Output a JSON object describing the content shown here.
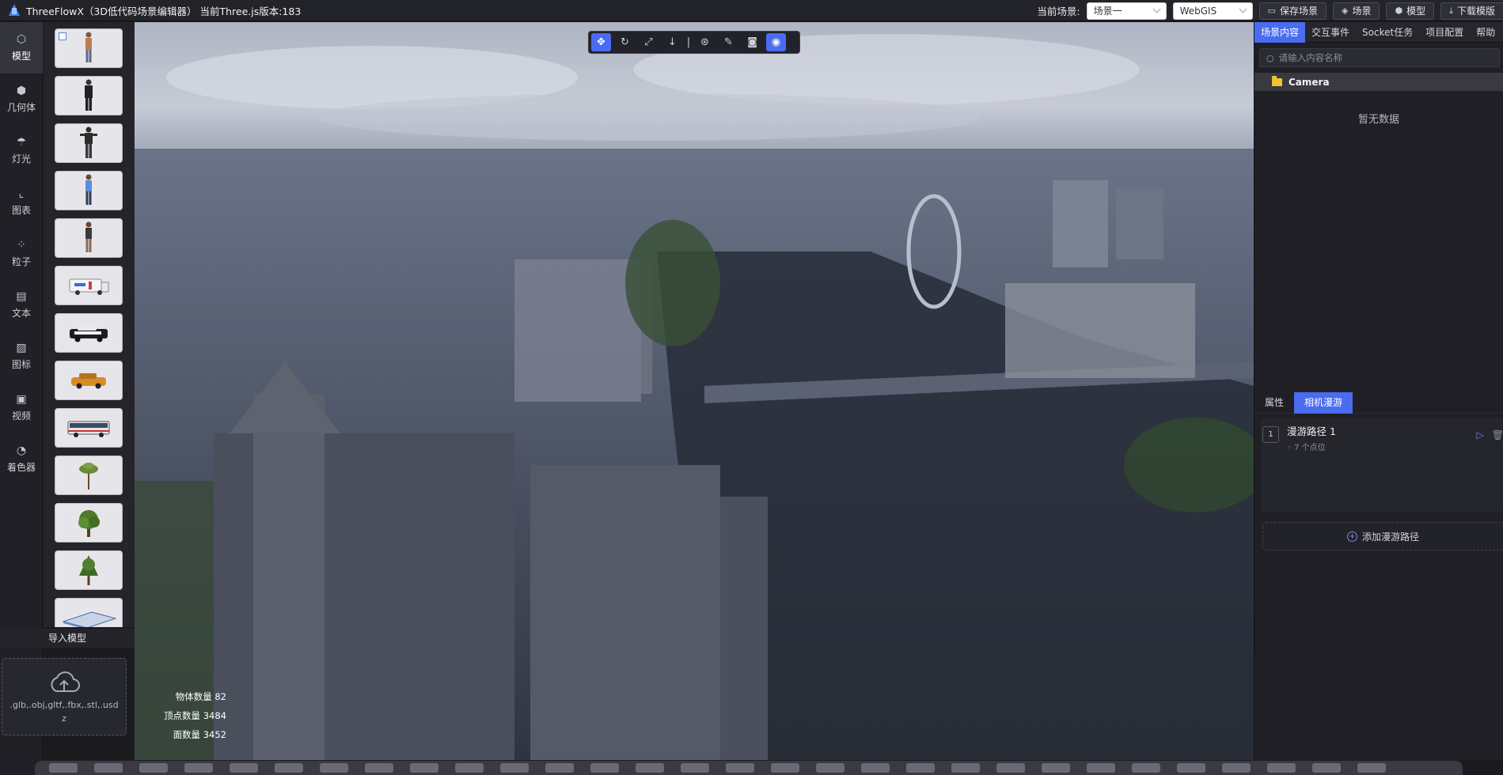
{
  "app": {
    "title": "ThreeFlowX（3D低代码场景编辑器） 当前Three.js版本:183"
  },
  "topbar": {
    "current_scene_label": "当前场景:",
    "scene_select": "场景一",
    "mode_select": "WebGIS",
    "buttons": [
      {
        "label": "保存场景",
        "icon": "save-icon"
      },
      {
        "label": "场景",
        "icon": "scene-icon"
      },
      {
        "label": "模型",
        "icon": "cube-icon"
      },
      {
        "label": "下载模版",
        "icon": "download-icon"
      }
    ]
  },
  "leftnav": {
    "items": [
      {
        "label": "模型",
        "icon": "cube-outline-icon",
        "active": true
      },
      {
        "label": "几何体",
        "icon": "geometry-icon"
      },
      {
        "label": "灯光",
        "icon": "light-icon"
      },
      {
        "label": "图表",
        "icon": "chart-icon"
      },
      {
        "label": "粒子",
        "icon": "particle-icon"
      },
      {
        "label": "文本",
        "icon": "text-icon"
      },
      {
        "label": "图标",
        "icon": "image-icon"
      },
      {
        "label": "视频",
        "icon": "video-icon"
      },
      {
        "label": "着色器",
        "icon": "shader-icon"
      }
    ]
  },
  "models": {
    "thumbnails": [
      "person-a",
      "person-b",
      "person-c",
      "person-d",
      "person-e",
      "ambulance",
      "police-car",
      "taxi",
      "bus",
      "tree-a",
      "tree-b",
      "tree-c",
      "building"
    ]
  },
  "import": {
    "title": "导入模型",
    "hint": ".glb,.obj,gltf,.fbx,.stl,.usdz"
  },
  "viewport": {
    "stats": [
      {
        "label": "物体数量",
        "value": "82"
      },
      {
        "label": "顶点数量",
        "value": "3484"
      },
      {
        "label": "面数量",
        "value": "3452"
      }
    ]
  },
  "gizmo": {
    "tools": [
      "move-icon",
      "rotate-icon",
      "scale-icon",
      "drop-icon",
      "|",
      "pivot-icon",
      "edit-icon",
      "camera-icon",
      "eye-toggle-icon"
    ]
  },
  "rightpanel": {
    "tabs": [
      "场景内容",
      "交互事件",
      "Socket任务",
      "项目配置",
      "帮助"
    ],
    "search_placeholder": "请输入内容名称",
    "tree_item": "Camera",
    "empty_text": "暂无数据",
    "property_tabs": [
      "属性",
      "相机漫游"
    ],
    "path": {
      "index": "1",
      "name": "漫游路径 1",
      "sub": "7 个点位"
    },
    "add_path": "添加漫游路径"
  },
  "colors": {
    "accent": "#4a6cf0",
    "panel": "#1f1f25",
    "folder": "#f2c230"
  }
}
